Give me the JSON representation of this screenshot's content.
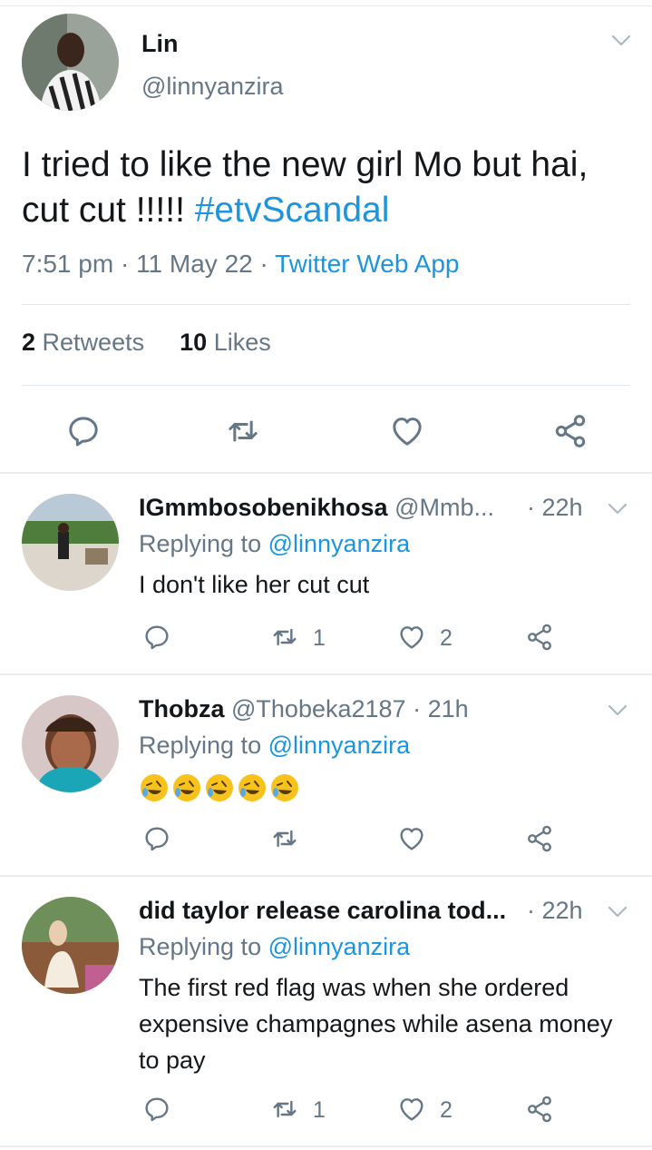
{
  "colors": {
    "link": "#1b95e0",
    "secondary": "#657786",
    "border": "#e6ecf0",
    "text": "#14171a"
  },
  "main_tweet": {
    "author_name": "Lin",
    "author_handle": "@linnyanzira",
    "text_before": "I tried to like the new girl Mo but hai, cut cut !!!!! ",
    "hashtag": "#etvScandal",
    "time": "7:51 pm",
    "date": "11 May 22",
    "dot": "·",
    "source": "Twitter Web App",
    "retweets_count": "2",
    "retweets_label": "Retweets",
    "likes_count": "10",
    "likes_label": "Likes",
    "actions": [
      "reply-icon",
      "retweet-icon",
      "like-icon",
      "share-icon"
    ]
  },
  "replies": [
    {
      "name": "IGmmbosobenikhosa",
      "handle": "@Mmb...",
      "time": "· 22h",
      "replying_label": "Replying to",
      "replying_handle": "@linnyanzira",
      "text": "I don't like her cut cut",
      "retweet_count": "1",
      "like_count": "2"
    },
    {
      "name": "Thobza",
      "handle": "@Thobeka2187",
      "time": "· 21h",
      "replying_label": "Replying to",
      "replying_handle": "@linnyanzira",
      "emoji": "🤣🤣🤣🤣🤣",
      "retweet_count": "",
      "like_count": ""
    },
    {
      "name": "did taylor release carolina tod...",
      "handle": "",
      "time": "· 22h",
      "replying_label": "Replying to",
      "replying_handle": "@linnyanzira",
      "text": "The first red flag was when she ordered expensive champagnes while asena money to pay",
      "retweet_count": "1",
      "like_count": "2"
    }
  ]
}
